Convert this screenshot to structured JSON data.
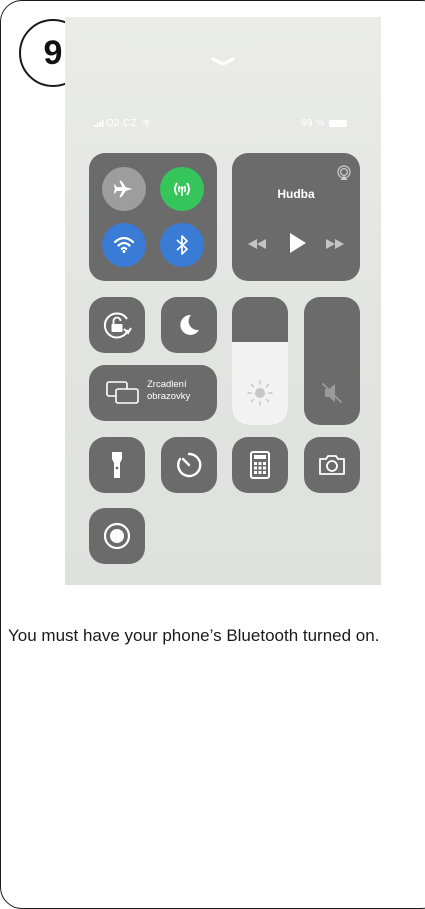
{
  "step": {
    "number": "9"
  },
  "status_bar": {
    "carrier": "O2.CZ",
    "battery_text": "99 %"
  },
  "music": {
    "title": "Hudba"
  },
  "screen_mirroring": {
    "line1": "Zrcadlení",
    "line2": "obrazovky"
  },
  "brightness": {
    "level_percent": 65
  },
  "caption": {
    "text": "You must have your phone’s Bluetooth turned on."
  },
  "colors": {
    "wifi_active": "#3a7bd5",
    "bluetooth_active": "#3a7bd5",
    "cellular_active": "#35c55a",
    "tile": "#6b6b6b"
  },
  "icons": [
    "chevron-down-icon",
    "airplane-icon",
    "cellular-icon",
    "wifi-icon",
    "bluetooth-icon",
    "airplay-icon",
    "rewind-icon",
    "play-icon",
    "fast-forward-icon",
    "rotation-lock-icon",
    "moon-icon",
    "screen-mirror-icon",
    "brightness-icon",
    "mute-icon",
    "flashlight-icon",
    "timer-icon",
    "calculator-icon",
    "camera-icon",
    "record-icon"
  ]
}
